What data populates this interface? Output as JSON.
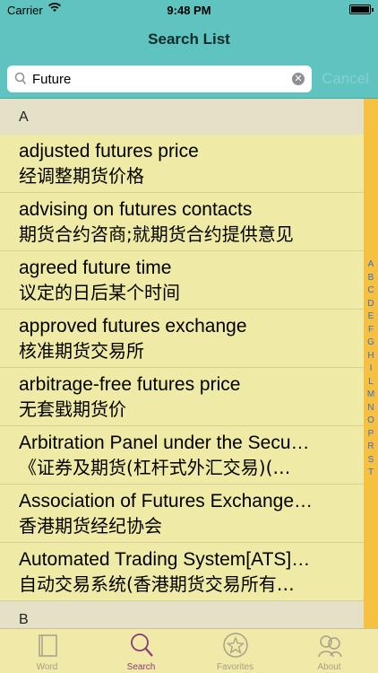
{
  "status_bar": {
    "carrier": "Carrier",
    "time": "9:48 PM"
  },
  "nav": {
    "title": "Search List"
  },
  "search": {
    "value": "Future",
    "cancel_label": "Cancel"
  },
  "sections": [
    {
      "header": "A",
      "rows": [
        {
          "en": "adjusted futures price",
          "zh": "经调整期货价格"
        },
        {
          "en": "advising on futures contacts",
          "zh": "期货合约咨商;就期货合约提供意见"
        },
        {
          "en": "agreed future time",
          "zh": "议定的日后某个时间"
        },
        {
          "en": "approved futures exchange",
          "zh": "核准期货交易所"
        },
        {
          "en": "arbitrage-free futures price",
          "zh": "无套戥期货价"
        },
        {
          "en": "Arbitration Panel under the Secu…",
          "zh": "《证券及期货(杠杆式外汇交易)(…"
        },
        {
          "en": "Association of Futures Exchange…",
          "zh": "香港期货经纪协会"
        },
        {
          "en": "Automated Trading System[ATS]…",
          "zh": "自动交易系统(香港期货交易所有…"
        }
      ]
    },
    {
      "header": "B",
      "rows": []
    }
  ],
  "index_letters": [
    "A",
    "B",
    "C",
    "D",
    "E",
    "F",
    "G",
    "H",
    "I",
    "L",
    "M",
    "N",
    "O",
    "P",
    "R",
    "S",
    "T"
  ],
  "tabs": [
    {
      "label": "Word",
      "icon": "book-icon"
    },
    {
      "label": "Search",
      "icon": "search-icon"
    },
    {
      "label": "Favorites",
      "icon": "star-icon"
    },
    {
      "label": "About",
      "icon": "about-icon"
    }
  ],
  "colors": {
    "nav": "#5fc3c0",
    "list": "#efeaa6",
    "index_bar": "#f6c040",
    "tab_active": "#8a3a7a",
    "tab_inactive": "#a6a08a"
  }
}
